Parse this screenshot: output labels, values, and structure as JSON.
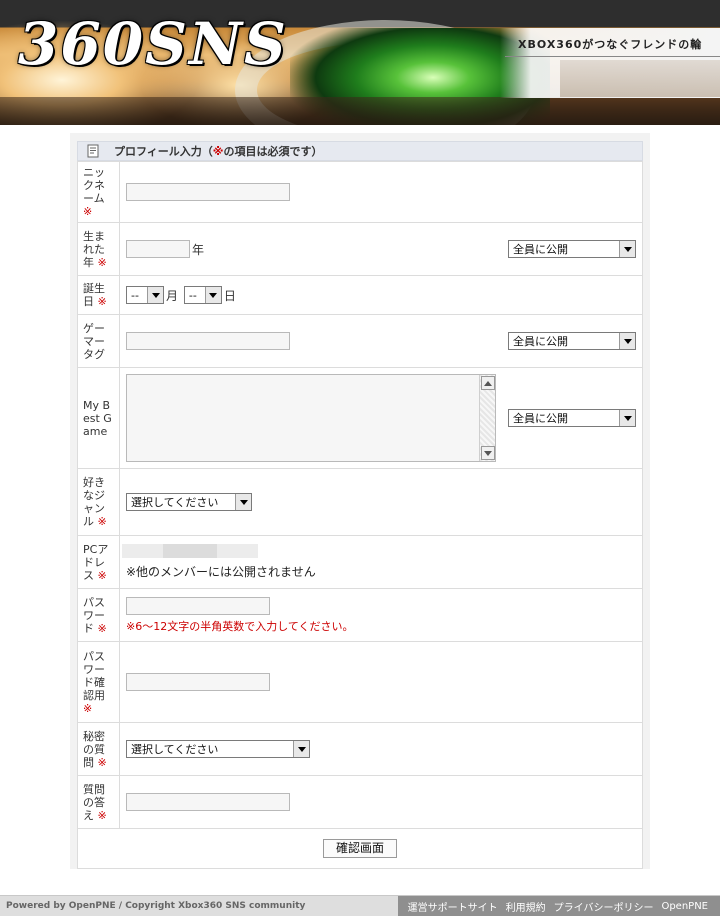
{
  "header": {
    "logo_text": "360SNS",
    "tagline": "XBOX360がつなぐフレンドの輪"
  },
  "form": {
    "title": "プロフィール入力（",
    "title_required_mark": "※",
    "title_suffix": "の項目は必須です）",
    "required_mark": "※",
    "rows": {
      "nickname": {
        "label": "ニックネーム",
        "value": ""
      },
      "birth_year": {
        "label": "生まれた年",
        "value": "",
        "unit": "年",
        "visibility": "全員に公開"
      },
      "birthday": {
        "label": "誕生日",
        "month": "--",
        "month_unit": "月",
        "day": "--",
        "day_unit": "日"
      },
      "gamertag": {
        "label": "ゲーマータグ",
        "value": "",
        "visibility": "全員に公開"
      },
      "best_game": {
        "label": "My Best Game",
        "value": "",
        "visibility": "全員に公開"
      },
      "genre": {
        "label": "好きなジャンル",
        "selected": "選択してください"
      },
      "pc_address": {
        "label": "PCアドレス",
        "note": "※他のメンバーには公開されません"
      },
      "password": {
        "label": "パスワード",
        "value": "",
        "hint": "※6〜12文字の半角英数で入力してください。"
      },
      "password_confirm": {
        "label": "パスワード確認用",
        "value": ""
      },
      "secret_question": {
        "label": "秘密の質問",
        "selected": "選択してください"
      },
      "secret_answer": {
        "label": "質問の答え",
        "value": ""
      }
    },
    "submit_label": "確認画面"
  },
  "footer": {
    "powered": "Powered by OpenPNE / Copyright Xbox360 SNS community",
    "links": [
      "運営サポートサイト",
      "利用規約",
      "プライバシーポリシー",
      "OpenPNE"
    ]
  }
}
